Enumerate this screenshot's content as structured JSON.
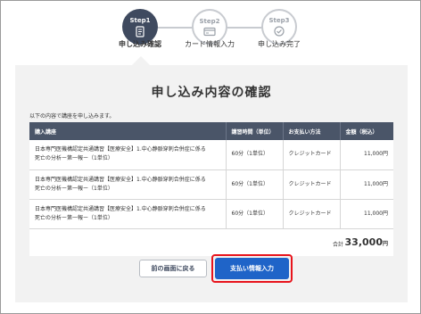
{
  "stepper": {
    "steps": [
      {
        "num": "Step1",
        "label": "申し込み確認",
        "icon": "document-icon",
        "state": "active"
      },
      {
        "num": "Step2",
        "label": "カード情報入力",
        "icon": "card-icon",
        "state": "inactive"
      },
      {
        "num": "Step3",
        "label": "申し込み完了",
        "icon": "check-icon",
        "state": "inactive"
      }
    ]
  },
  "page": {
    "title": "申し込み内容の確認",
    "intro": "以下の内容で講座を申し込みます。"
  },
  "table": {
    "headers": [
      "購入講座",
      "講習時間（単位）",
      "お支払い方法",
      "金額（税込）"
    ],
    "rows": [
      {
        "course_line1": "日本専門医機構認定共通講習【医療安全】1.中心静脈穿刺合併症に係る",
        "course_line2": "死亡の分析ー第一報ー（1単位）",
        "hours": "60分（1単位）",
        "payment": "クレジットカード",
        "amount": "11,000円"
      },
      {
        "course_line1": "日本専門医機構認定共通講習【医療安全】1.中心静脈穿刺合併症に係る",
        "course_line2": "死亡の分析ー第一報ー（1単位）",
        "hours": "60分（1単位）",
        "payment": "クレジットカード",
        "amount": "11,000円"
      },
      {
        "course_line1": "日本専門医機構認定共通講習【医療安全】1.中心静脈穿刺合併症に係る",
        "course_line2": "死亡の分析ー第一報ー（1単位）",
        "hours": "60分（1単位）",
        "payment": "クレジットカード",
        "amount": "11,000円"
      }
    ],
    "total_label": "合計",
    "total_value": "33,000",
    "total_unit": "円"
  },
  "actions": {
    "back_label": "前の画面に戻る",
    "pay_label": "支払い情報入力"
  },
  "colors": {
    "active_step": "#3f4a5f",
    "header_bg": "#4a5568",
    "primary_button": "#1f64c8",
    "highlight": "#e8141c"
  }
}
